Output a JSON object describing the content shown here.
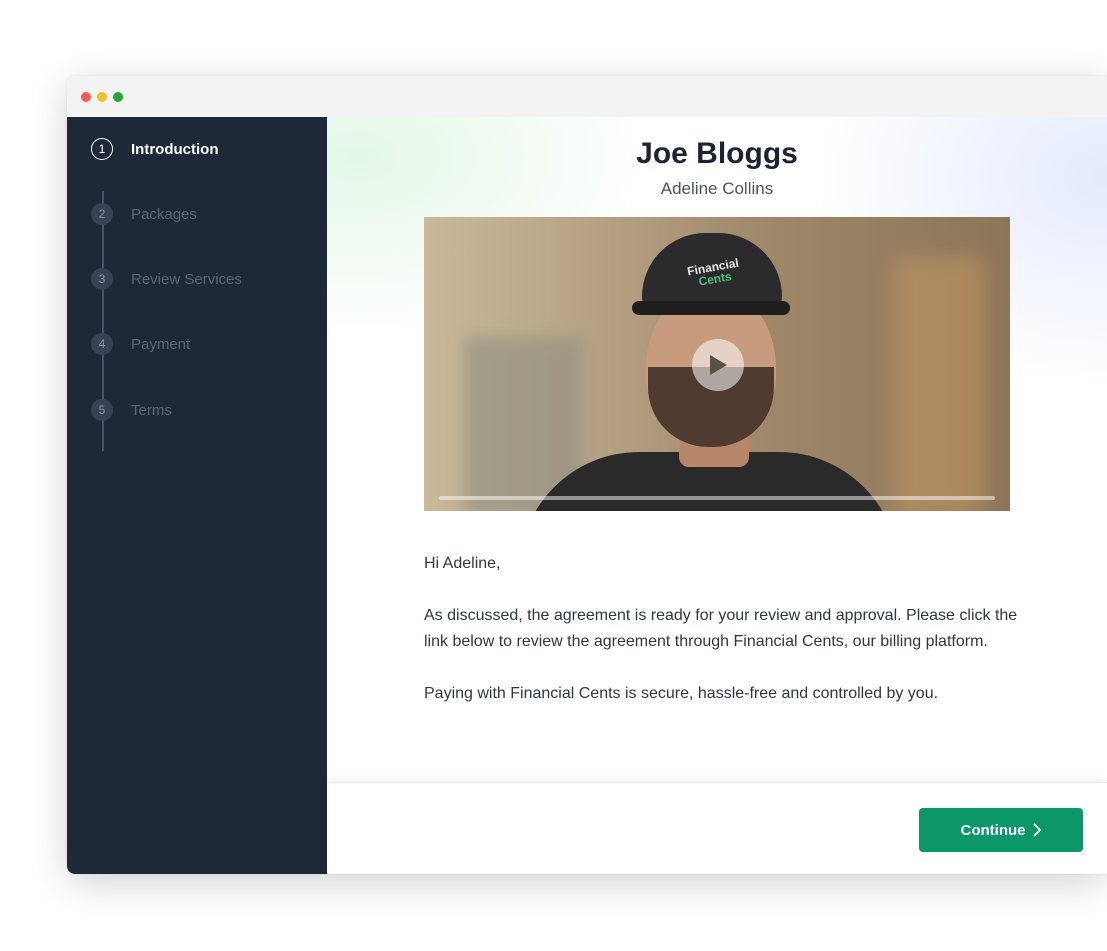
{
  "window": {
    "traffic_lights": {
      "close": "#ee5e56",
      "minimize": "#f4c02e",
      "maximize": "#23a637"
    }
  },
  "sidebar": {
    "background": "#1f2839",
    "steps": [
      {
        "number": "1",
        "label": "Introduction",
        "active": true
      },
      {
        "number": "2",
        "label": "Packages",
        "active": false
      },
      {
        "number": "3",
        "label": "Review Services",
        "active": false
      },
      {
        "number": "4",
        "label": "Payment",
        "active": false
      },
      {
        "number": "5",
        "label": "Terms",
        "active": false
      }
    ]
  },
  "main": {
    "title": "Joe Bloggs",
    "subtitle": "Adeline Collins",
    "video": {
      "cap_text_line1": "Financial",
      "cap_text_line2": "Cents",
      "play_icon": "play-icon",
      "progress_percent": 0
    },
    "message": {
      "greeting": "Hi Adeline,",
      "paragraph1": "As discussed, the agreement is ready for your review and approval. Please click the link below to review the agreement through Financial Cents, our billing platform.",
      "paragraph2": "Paying with Financial Cents is secure, hassle-free and controlled by you."
    }
  },
  "footer": {
    "continue_label": "Continue",
    "continue_icon": "chevron-right-icon",
    "accent": "#0c9768"
  }
}
